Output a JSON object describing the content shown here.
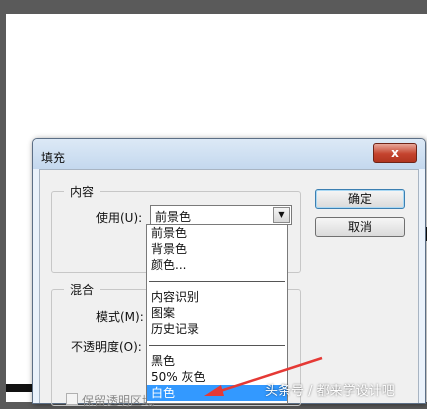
{
  "dialog": {
    "title": "填充",
    "close_glyph": "x",
    "ok_label": "确定",
    "cancel_label": "取消"
  },
  "content_group": {
    "legend": "内容",
    "use_label": "使用(U):",
    "use_value": "前景色"
  },
  "blend_group": {
    "legend": "混合",
    "mode_label": "模式(M):",
    "opacity_label": "不透明度(O):",
    "preserve_label": "保留透明区域"
  },
  "dropdown": {
    "group1": [
      "前景色",
      "背景色",
      "颜色..."
    ],
    "group2": [
      "内容识别",
      "图案",
      "历史记录"
    ],
    "group3": [
      "黑色",
      "50% 灰色",
      "白色"
    ],
    "selected": "白色"
  },
  "annotation": {
    "arrow_color": "#e53935"
  },
  "watermark": "头条号 / 都来学设计吧"
}
